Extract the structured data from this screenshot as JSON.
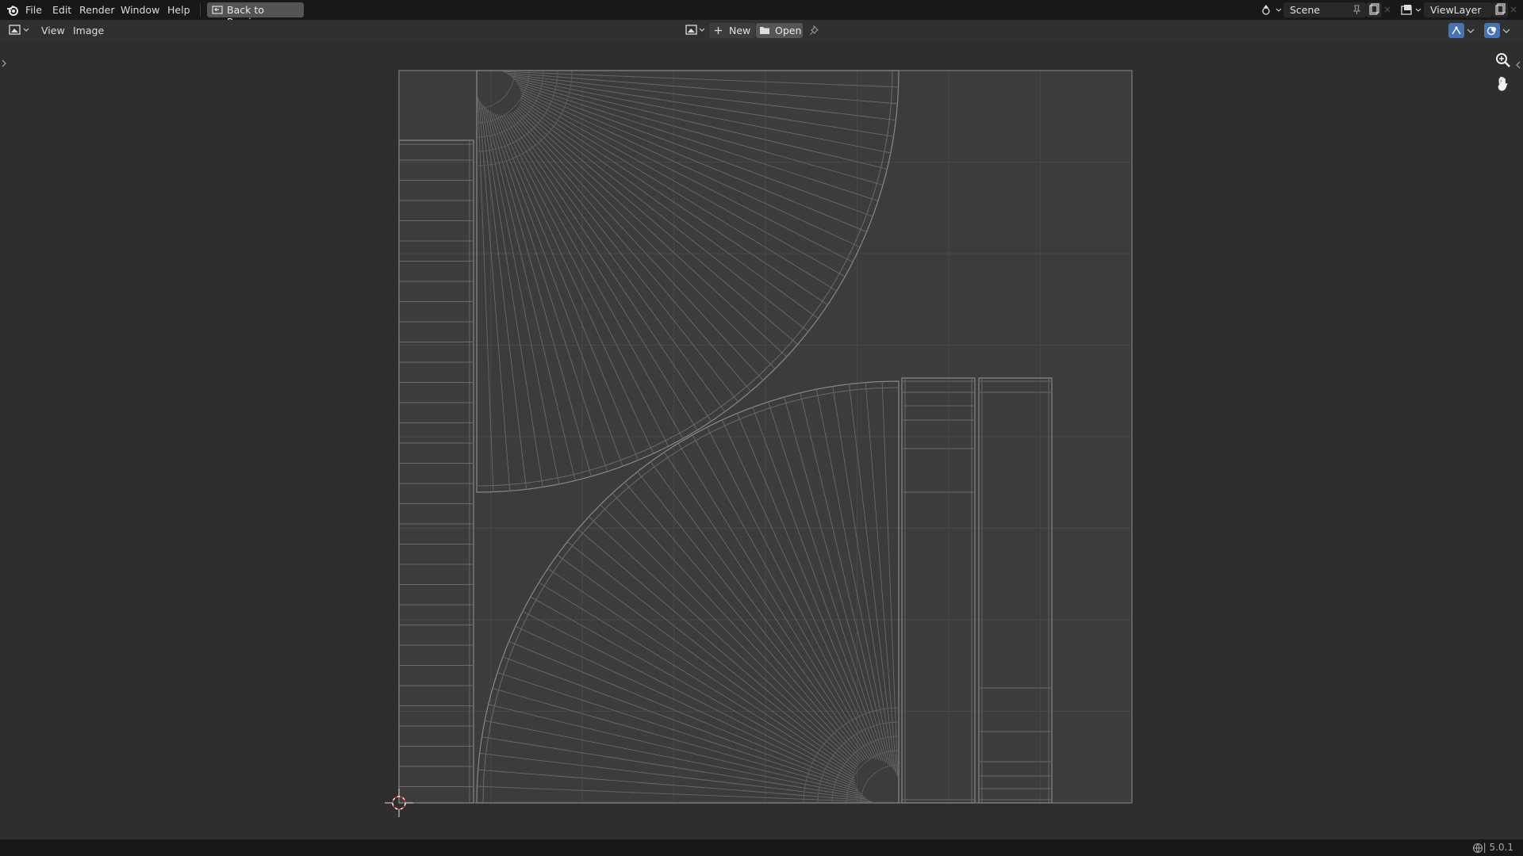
{
  "topbar": {
    "menu": [
      "File",
      "Edit",
      "Render",
      "Window",
      "Help"
    ],
    "back_button": "Back to Previous",
    "scene": "Scene",
    "view_layer": "ViewLayer"
  },
  "editor_header": {
    "menu": [
      "View",
      "Image"
    ],
    "new_button": "New",
    "open_button": "Open"
  },
  "status": {
    "version": "5.0.1"
  },
  "colors": {
    "topbar": "#181818",
    "background": "#303030",
    "wire": "#8c8c8c",
    "accent": "#4772b3"
  },
  "icons": [
    "blender-logo-icon",
    "back-icon",
    "image-editor-icon",
    "image-browse-icon",
    "plus-icon",
    "folder-icon",
    "pin-icon",
    "scene-icon",
    "new-scene-icon",
    "view-layer-icon",
    "gizmo-icon",
    "overlay-icon",
    "zoom-icon",
    "hand-icon",
    "cursor-icon",
    "globe-icon"
  ]
}
